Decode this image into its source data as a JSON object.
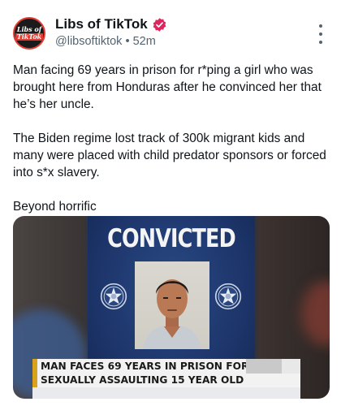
{
  "author": {
    "avatar_line1": "Libs of",
    "avatar_line2": "TikTok",
    "display_name": "Libs of TikTok",
    "handle": "@libsoftiktok",
    "separator": "•",
    "time": "52m",
    "verified_color": "#e0245e"
  },
  "post": {
    "paragraphs": [
      "Man facing 69 years in prison for r*ping a girl who was brought here from Honduras after he convinced her that he’s her uncle.",
      "The Biden regime lost track of 300k migrant kids and many were placed with child predator sponsors or forced into s*x slavery.",
      "Beyond horrific"
    ]
  },
  "media": {
    "headline": "CONVICTED",
    "chyron_line1": "MAN FACES 69 YEARS IN PRISON FOR",
    "chyron_line2": "SEXUALLY ASSAULTING 15 YEAR OLD",
    "accent_color": "#d9a21b",
    "board_color": "#1d2f55"
  },
  "icons": {
    "more": "more-vertical-icon",
    "verified": "verified-badge-icon",
    "badge": "sheriff-star-badge-icon"
  }
}
